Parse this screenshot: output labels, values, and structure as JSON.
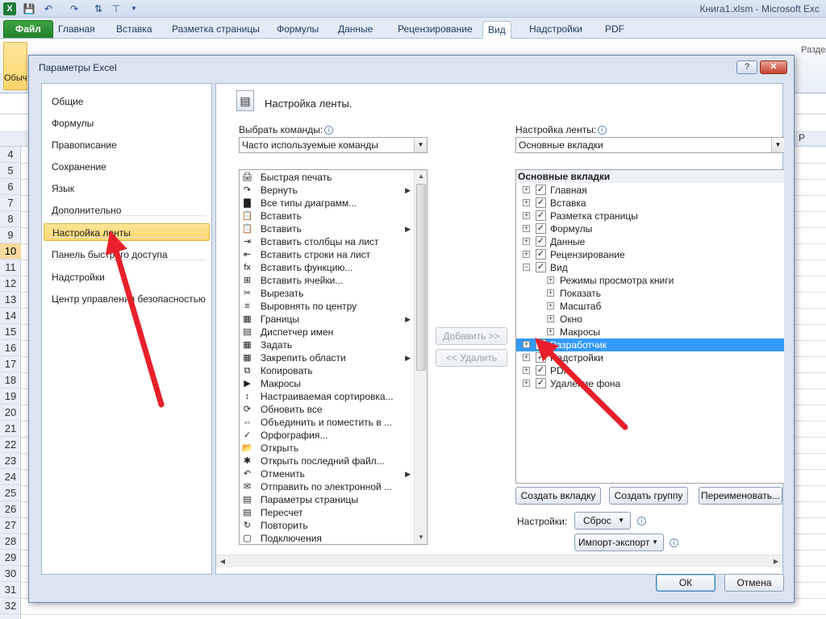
{
  "window": {
    "title": "Книга1.xlsm - Microsoft Exc"
  },
  "ribbon_tabs": [
    {
      "label": "Файл"
    },
    {
      "label": "Главная"
    },
    {
      "label": "Вставка"
    },
    {
      "label": "Разметка страницы"
    },
    {
      "label": "Формулы"
    },
    {
      "label": "Данные"
    },
    {
      "label": "Рецензирование"
    },
    {
      "label": "Вид"
    },
    {
      "label": "Надстройки"
    },
    {
      "label": "PDF"
    }
  ],
  "ribbon": {
    "normal_label": "Обыч",
    "split_label": "Разделить"
  },
  "sheet": {
    "rows": [
      "4",
      "5",
      "6",
      "7",
      "8",
      "9",
      "10",
      "11",
      "12",
      "13",
      "14",
      "15",
      "16",
      "17",
      "18",
      "19",
      "20",
      "21",
      "22",
      "23",
      "24",
      "25",
      "26",
      "27",
      "28",
      "29",
      "30",
      "31",
      "32"
    ],
    "selected_row": "10",
    "col_p": "P"
  },
  "dialog": {
    "title": "Параметры Excel",
    "help_btn": "?",
    "close_btn": "✕",
    "nav": [
      {
        "label": "Общие"
      },
      {
        "label": "Формулы"
      },
      {
        "label": "Правописание"
      },
      {
        "label": "Сохранение"
      },
      {
        "label": "Язык"
      },
      {
        "label": "Дополнительно"
      },
      {
        "label": "Настройка ленты"
      },
      {
        "label": "Панель быстрого доступа"
      },
      {
        "label": "Надстройки"
      },
      {
        "label": "Центр управления безопасностью"
      }
    ],
    "header": "Настройка ленты.",
    "choose_label": "Выбрать команды:",
    "choose_value": "Часто используемые команды",
    "customize_label": "Настройка ленты:",
    "customize_value": "Основные вкладки",
    "commands": [
      {
        "label": "Быстрая печать",
        "icon": "🖨",
        "sub": false
      },
      {
        "label": "Вернуть",
        "icon": "↷",
        "sub": true
      },
      {
        "label": "Все типы диаграмм...",
        "icon": "▇",
        "sub": false
      },
      {
        "label": "Вставить",
        "icon": "📋",
        "sub": false
      },
      {
        "label": "Вставить",
        "icon": "📋",
        "sub": true
      },
      {
        "label": "Вставить столбцы на лист",
        "icon": "⇥",
        "sub": false
      },
      {
        "label": "Вставить строки на лист",
        "icon": "⇤",
        "sub": false
      },
      {
        "label": "Вставить функцию...",
        "icon": "fx",
        "sub": false
      },
      {
        "label": "Вставить ячейки...",
        "icon": "⊞",
        "sub": false
      },
      {
        "label": "Вырезать",
        "icon": "✂",
        "sub": false
      },
      {
        "label": "Выровнять по центру",
        "icon": "≡",
        "sub": false
      },
      {
        "label": "Границы",
        "icon": "▦",
        "sub": true
      },
      {
        "label": "Диспетчер имен",
        "icon": "▤",
        "sub": false
      },
      {
        "label": "Задать",
        "icon": "▦",
        "sub": false
      },
      {
        "label": "Закрепить области",
        "icon": "▦",
        "sub": true
      },
      {
        "label": "Копировать",
        "icon": "⧉",
        "sub": false
      },
      {
        "label": "Макросы",
        "icon": "▶",
        "sub": false
      },
      {
        "label": "Настраиваемая сортировка...",
        "icon": "↕",
        "sub": false
      },
      {
        "label": "Обновить все",
        "icon": "⟳",
        "sub": false
      },
      {
        "label": "Объединить и поместить в ...",
        "icon": "⇔",
        "sub": false
      },
      {
        "label": "Орфография...",
        "icon": "✓",
        "sub": false
      },
      {
        "label": "Открыть",
        "icon": "📂",
        "sub": false
      },
      {
        "label": "Открыть последний файл...",
        "icon": "✱",
        "sub": false
      },
      {
        "label": "Отменить",
        "icon": "↶",
        "sub": true
      },
      {
        "label": "Отправить по электронной ...",
        "icon": "✉",
        "sub": false
      },
      {
        "label": "Параметры страницы",
        "icon": "▤",
        "sub": false
      },
      {
        "label": "Пересчет",
        "icon": "▤",
        "sub": false
      },
      {
        "label": "Повторить",
        "icon": "↻",
        "sub": false
      },
      {
        "label": "Подключения",
        "icon": "▢",
        "sub": false
      }
    ],
    "add_btn": "Добавить >>",
    "remove_btn": "<< Удалить",
    "tree_header": "Основные вкладки",
    "tree": [
      {
        "label": "Главная",
        "level": 0,
        "expander": "+",
        "checked": true,
        "selected": false
      },
      {
        "label": "Вставка",
        "level": 0,
        "expander": "+",
        "checked": true,
        "selected": false
      },
      {
        "label": "Разметка страницы",
        "level": 0,
        "expander": "+",
        "checked": true,
        "selected": false
      },
      {
        "label": "Формулы",
        "level": 0,
        "expander": "+",
        "checked": true,
        "selected": false
      },
      {
        "label": "Данные",
        "level": 0,
        "expander": "+",
        "checked": true,
        "selected": false
      },
      {
        "label": "Рецензирование",
        "level": 0,
        "expander": "+",
        "checked": true,
        "selected": false
      },
      {
        "label": "Вид",
        "level": 0,
        "expander": "−",
        "checked": true,
        "selected": false
      },
      {
        "label": "Режимы просмотра книги",
        "level": 1,
        "expander": "+",
        "checked": null,
        "selected": false
      },
      {
        "label": "Показать",
        "level": 1,
        "expander": "+",
        "checked": null,
        "selected": false
      },
      {
        "label": "Масштаб",
        "level": 1,
        "expander": "+",
        "checked": null,
        "selected": false
      },
      {
        "label": "Окно",
        "level": 1,
        "expander": "+",
        "checked": null,
        "selected": false
      },
      {
        "label": "Макросы",
        "level": 1,
        "expander": "+",
        "checked": null,
        "selected": false
      },
      {
        "label": "Разработчик",
        "level": 0,
        "expander": "+",
        "checked": true,
        "selected": true
      },
      {
        "label": "Надстройки",
        "level": 0,
        "expander": "+",
        "checked": true,
        "selected": false
      },
      {
        "label": "PDF",
        "level": 0,
        "expander": "+",
        "checked": true,
        "selected": false
      },
      {
        "label": "Удаление фона",
        "level": 0,
        "expander": "+",
        "checked": true,
        "selected": false
      }
    ],
    "new_tab_btn": "Создать вкладку",
    "new_group_btn": "Создать группу",
    "rename_btn": "Переименовать...",
    "settings_label": "Настройки:",
    "reset_btn": "Сброс",
    "import_btn": "Импорт-экспорт",
    "ok_btn": "ОК",
    "cancel_btn": "Отмена"
  },
  "colors": {
    "accent": "#3399ff",
    "annotation_arrow": "#e8202a",
    "nav_selected": "#fbd66a"
  }
}
